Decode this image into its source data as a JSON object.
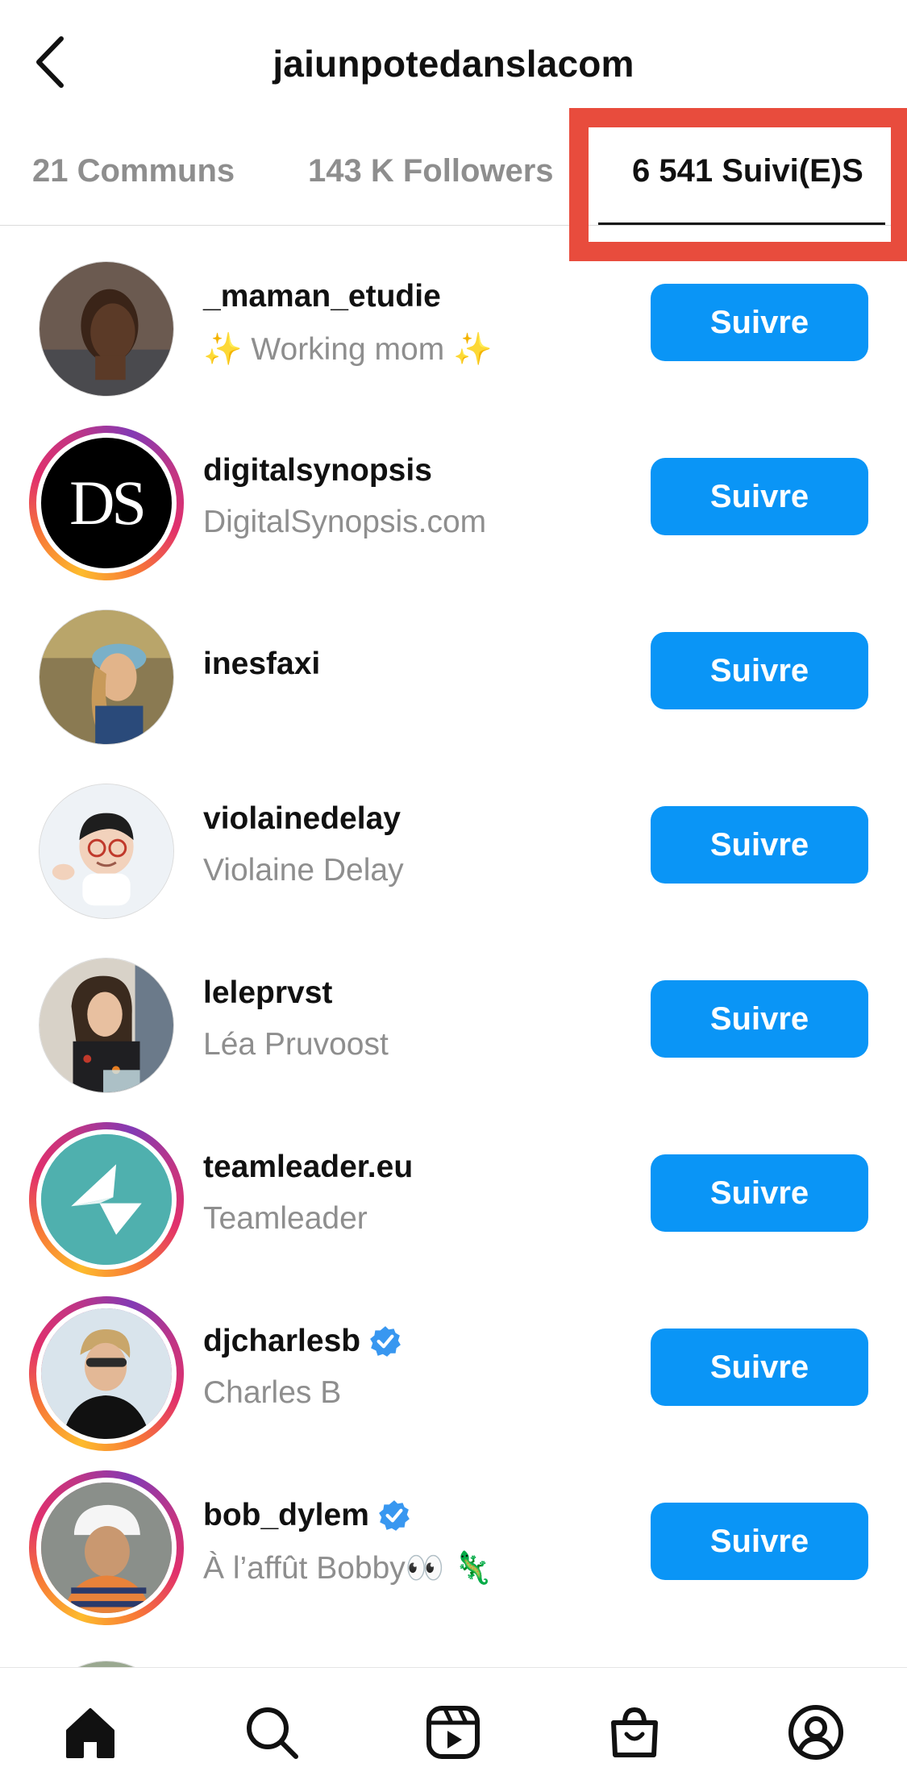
{
  "header": {
    "title": "jaiunpotedanslacom",
    "back_icon": "chevron-left-icon"
  },
  "tabs": [
    {
      "label": "21 Communs",
      "active": false
    },
    {
      "label": "143 K Followers",
      "active": false
    },
    {
      "label": "6 541 Suivi(E)S",
      "active": true
    }
  ],
  "highlight_color": "#e84c3d",
  "accent_color": "#0a95f6",
  "follow_label": "Suivre",
  "accounts": [
    {
      "username": "_maman_etudie",
      "subtitle": "✨ Working mom ✨",
      "verified": false,
      "story": false,
      "avatar": "portrait-photo"
    },
    {
      "username": "digitalsynopsis",
      "subtitle": "DigitalSynopsis.com",
      "verified": false,
      "story": true,
      "avatar": "ds-logo",
      "logo_text": "DS"
    },
    {
      "username": "inesfaxi",
      "subtitle": "",
      "verified": false,
      "story": false,
      "avatar": "portrait-photo"
    },
    {
      "username": "violainedelay",
      "subtitle": "Violaine Delay",
      "verified": false,
      "story": false,
      "avatar": "memoji"
    },
    {
      "username": "leleprvst",
      "subtitle": "Léa Pruvoost",
      "verified": false,
      "story": false,
      "avatar": "portrait-photo"
    },
    {
      "username": "teamleader.eu",
      "subtitle": "Teamleader",
      "verified": false,
      "story": true,
      "avatar": "teamleader-logo"
    },
    {
      "username": "djcharlesb",
      "subtitle": "Charles B",
      "verified": true,
      "story": true,
      "avatar": "portrait-photo"
    },
    {
      "username": "bob_dylem",
      "subtitle": "À l’affût Bobby👀 🦎",
      "verified": true,
      "story": true,
      "avatar": "portrait-photo"
    }
  ],
  "bottom_nav": [
    {
      "name": "home-icon",
      "active": true
    },
    {
      "name": "search-icon",
      "active": false
    },
    {
      "name": "reels-icon",
      "active": false
    },
    {
      "name": "shop-icon",
      "active": false
    },
    {
      "name": "profile-icon",
      "active": false
    }
  ]
}
